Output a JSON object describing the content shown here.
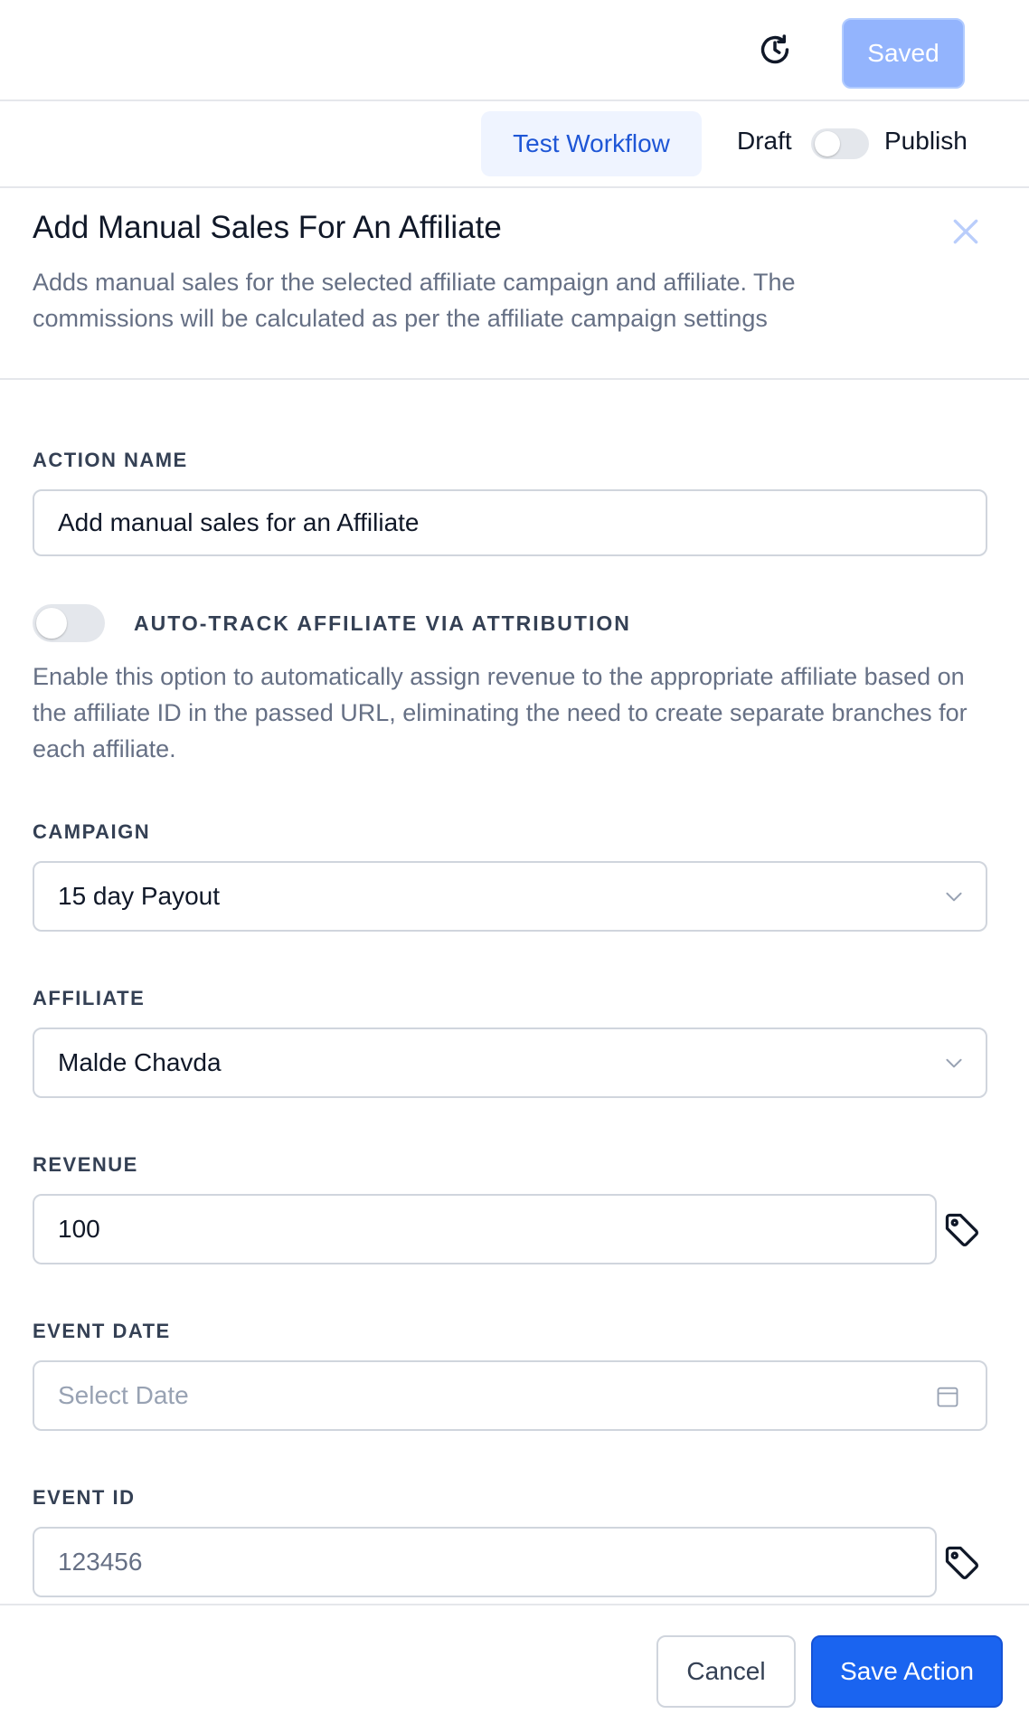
{
  "topbar": {
    "saved_label": "Saved",
    "history_icon": "history-clock-icon"
  },
  "workflow_bar": {
    "test_label": "Test Workflow",
    "draft_label": "Draft",
    "publish_label": "Publish",
    "publish_toggle_on": false
  },
  "header": {
    "title": "Add Manual Sales For An Affiliate",
    "description": "Adds manual sales for the selected affiliate campaign and affiliate. The commissions will be calculated as per the affiliate campaign settings",
    "close_icon": "close-icon"
  },
  "form": {
    "action_name": {
      "label": "ACTION NAME",
      "value": "Add manual sales for an Affiliate"
    },
    "auto_track": {
      "label": "AUTO-TRACK AFFILIATE VIA ATTRIBUTION",
      "enabled": false,
      "description": "Enable this option to automatically assign revenue to the appropriate affiliate based on the affiliate ID in the passed URL, eliminating the need to create separate branches for each affiliate."
    },
    "campaign": {
      "label": "CAMPAIGN",
      "value": "15 day Payout"
    },
    "affiliate": {
      "label": "AFFILIATE",
      "value": "Malde Chavda"
    },
    "revenue": {
      "label": "REVENUE",
      "value": "100"
    },
    "event_date": {
      "label": "EVENT DATE",
      "placeholder": "Select Date"
    },
    "event_id": {
      "label": "EVENT ID",
      "value": "123456"
    }
  },
  "footer": {
    "cancel_label": "Cancel",
    "save_label": "Save Action"
  },
  "colors": {
    "primary": "#1a64f0",
    "saved_disabled": "#93b4fd",
    "test_bg": "#eff4ff"
  }
}
